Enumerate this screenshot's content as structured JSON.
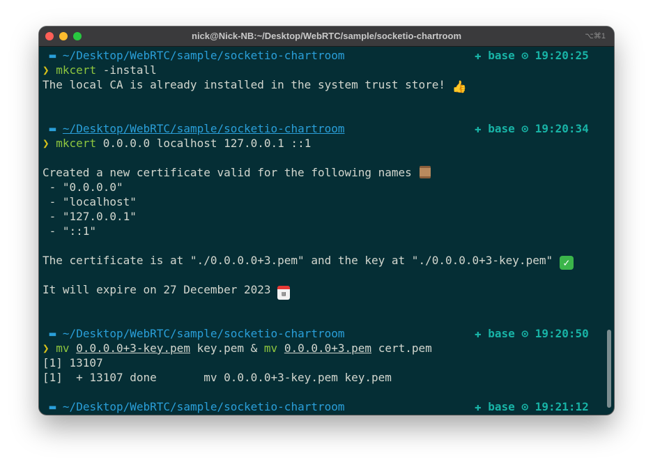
{
  "window": {
    "title": "nick@Nick-NB:~/Desktop/WebRTC/sample/socketio-chartroom",
    "shortcut": "⌥⌘1"
  },
  "icons": {
    "apple": "apple-icon",
    "folder": "folder-icon",
    "prompt_arrow": "❯",
    "env": "✚",
    "clock": "⊙"
  },
  "colors": {
    "background": "#052e35",
    "path": "#2a9fd9",
    "command": "#8ec63f",
    "prompt_arrow": "#d8c21a",
    "right_prompt": "#18b3a6",
    "output": "#d3d7cf"
  },
  "prompts": [
    {
      "path": "~/Desktop/WebRTC/sample/socketio-chartroom",
      "env": "base",
      "time": "19:20:25"
    },
    {
      "path": "~/Desktop/WebRTC/sample/socketio-chartroom",
      "env": "base",
      "time": "19:20:34"
    },
    {
      "path": "~/Desktop/WebRTC/sample/socketio-chartroom",
      "env": "base",
      "time": "19:20:50"
    },
    {
      "path": "~/Desktop/WebRTC/sample/socketio-chartroom",
      "env": "base",
      "time": "19:21:12"
    }
  ],
  "commands": {
    "c1": {
      "cmd": "mkcert",
      "args": " -install"
    },
    "c2": {
      "cmd": "mkcert",
      "args": " 0.0.0.0 localhost 127.0.0.1 ::1"
    },
    "c3": {
      "cmd1": "mv",
      "file1": "0.0.0.0+3-key.pem",
      "mid": " key.pem & ",
      "cmd2": "mv",
      "file2": "0.0.0.0+3.pem",
      "tail": " cert.pem"
    }
  },
  "output": {
    "ca_installed": "The local CA is already installed in the system trust store! ",
    "created": "Created a new certificate valid for the following names ",
    "names": [
      " - \"0.0.0.0\"",
      " - \"localhost\"",
      " - \"127.0.0.1\"",
      " - \"::1\""
    ],
    "cert_location": "The certificate is at \"./0.0.0.0+3.pem\" and the key at \"./0.0.0.0+3-key.pem\" ",
    "expire": "It will expire on 27 December 2023 ",
    "job_start": "[1] 13107",
    "job_done": "[1]  + 13107 done       mv 0.0.0.0+3-key.pem key.pem"
  }
}
